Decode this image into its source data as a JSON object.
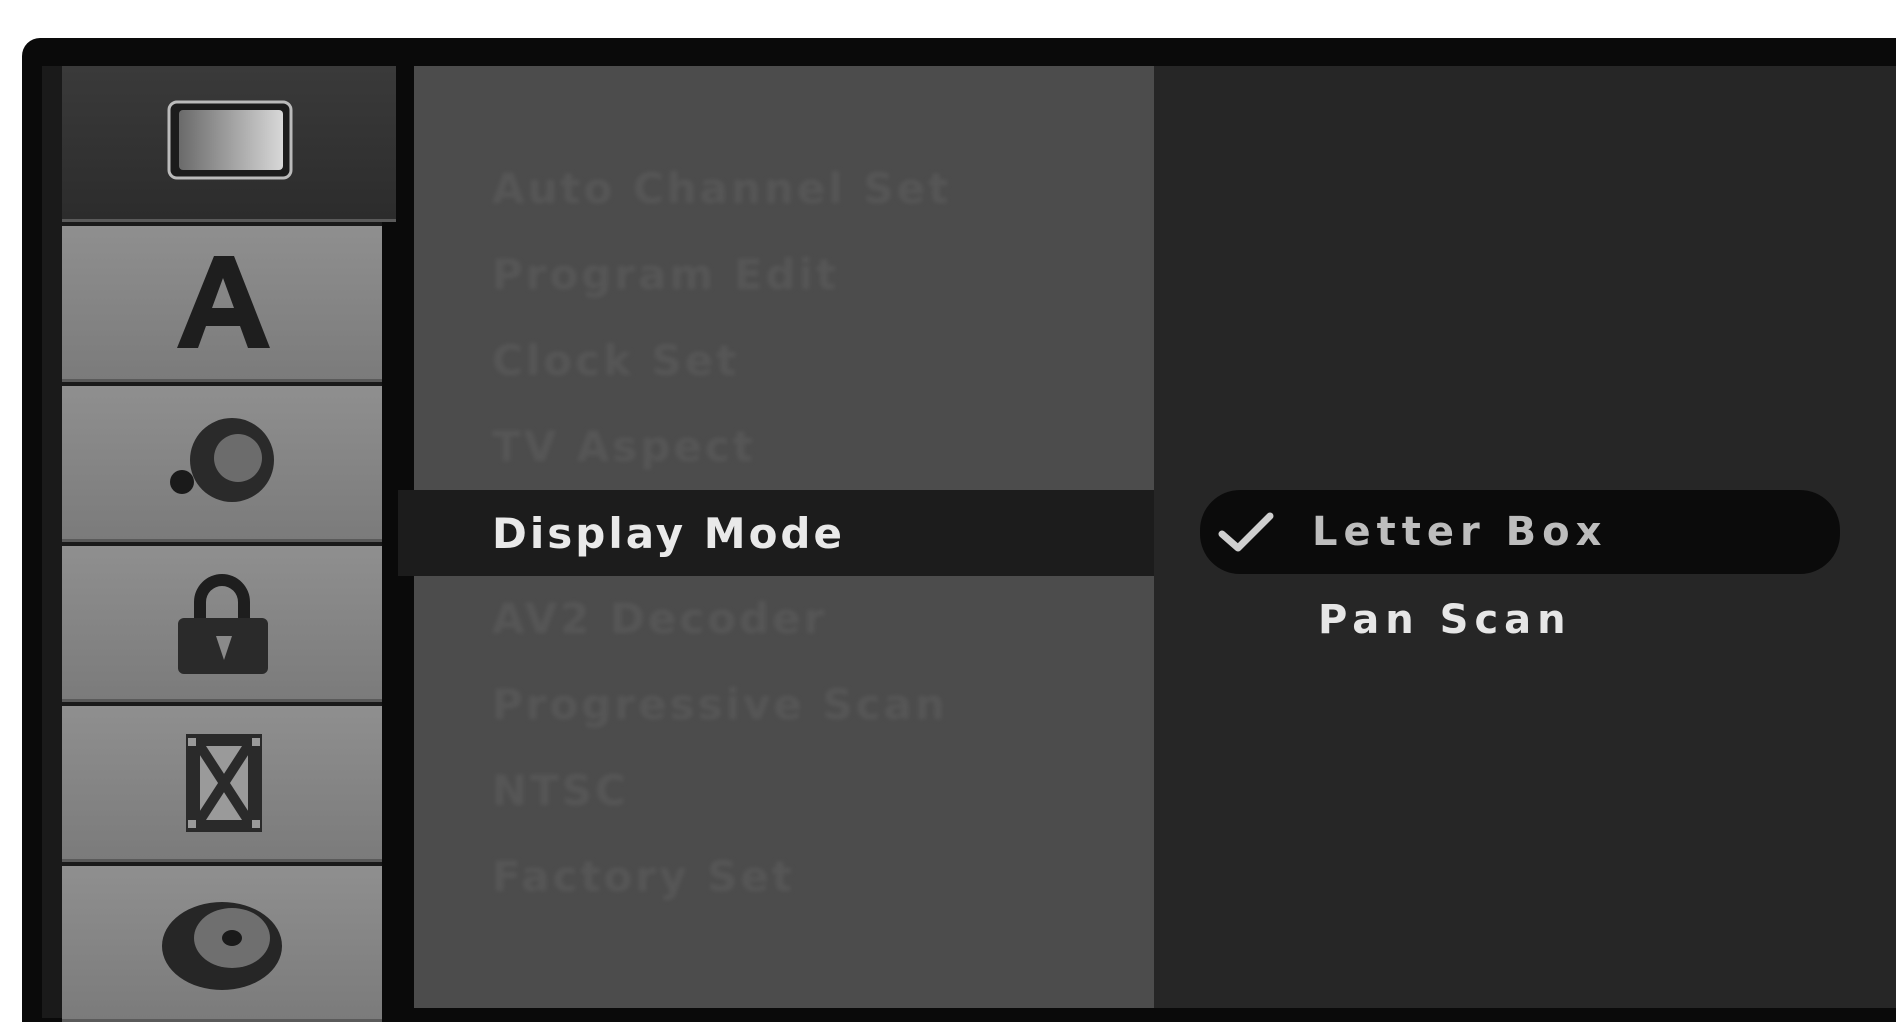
{
  "sidebar": {
    "items": [
      {
        "icon": "display-setup-icon",
        "active": true
      },
      {
        "icon": "language-icon",
        "active": false
      },
      {
        "icon": "audio-icon",
        "active": false
      },
      {
        "icon": "lock-icon",
        "active": false
      },
      {
        "icon": "recording-icon",
        "active": false
      },
      {
        "icon": "disc-icon",
        "active": false
      }
    ]
  },
  "menu": {
    "items": [
      {
        "label": "Auto Channel Set"
      },
      {
        "label": "Program Edit"
      },
      {
        "label": "Clock Set"
      },
      {
        "label": "TV Aspect"
      },
      {
        "label": "Display Mode",
        "selected": true
      },
      {
        "label": "AV2 Decoder"
      },
      {
        "label": "Progressive Scan"
      },
      {
        "label": "NTSC"
      },
      {
        "label": "Factory Set"
      }
    ]
  },
  "options": {
    "items": [
      {
        "label": "Letter Box",
        "checked": true
      },
      {
        "label": "Pan Scan",
        "checked": false
      }
    ],
    "check_icon": "checkmark-icon"
  }
}
